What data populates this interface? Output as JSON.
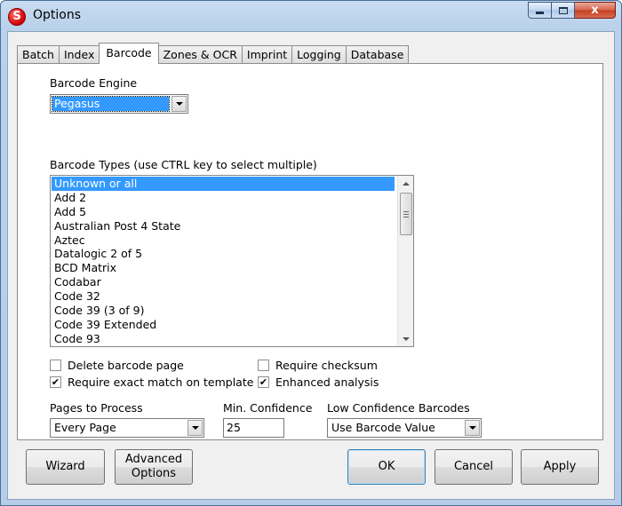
{
  "window": {
    "title": "Options",
    "app_icon": "S",
    "close_glyph": "x"
  },
  "tabs": [
    {
      "label": "Batch"
    },
    {
      "label": "Index"
    },
    {
      "label": "Barcode",
      "active": true
    },
    {
      "label": "Zones & OCR"
    },
    {
      "label": "Imprint"
    },
    {
      "label": "Logging"
    },
    {
      "label": "Database"
    }
  ],
  "barcode": {
    "engine_label": "Barcode Engine",
    "engine_value": "Pegasus",
    "types_label": "Barcode Types (use CTRL key to select multiple)",
    "types": [
      "Unknown or all",
      "Add 2",
      "Add 5",
      "Australian Post 4 State",
      "Aztec",
      "Datalogic 2 of 5",
      "BCD Matrix",
      "Codabar",
      "Code 32",
      "Code 39 (3 of 9)",
      "Code 39 Extended",
      "Code 93"
    ],
    "selected_type_index": 0,
    "delete_page": {
      "label": "Delete barcode page",
      "checked": false
    },
    "require_exact": {
      "label": "Require exact match on template",
      "checked": true
    },
    "require_checksum": {
      "label": "Require checksum",
      "checked": false
    },
    "enhanced": {
      "label": "Enhanced analysis",
      "checked": true
    },
    "pages_label": "Pages to Process",
    "pages_value": "Every Page",
    "min_conf_label": "Min. Confidence",
    "min_conf_value": "25",
    "low_conf_label": "Low Confidence Barcodes",
    "low_conf_value": "Use Barcode Value",
    "check_mark": "✔"
  },
  "buttons": {
    "wizard": "Wizard",
    "advanced_line1": "Advanced",
    "advanced_line2": "Options",
    "ok": "OK",
    "cancel": "Cancel",
    "apply": "Apply"
  },
  "colors": {
    "selection": "#3399ff",
    "title_gradient": "#b9d1ea",
    "close_red": "#c4401f"
  }
}
